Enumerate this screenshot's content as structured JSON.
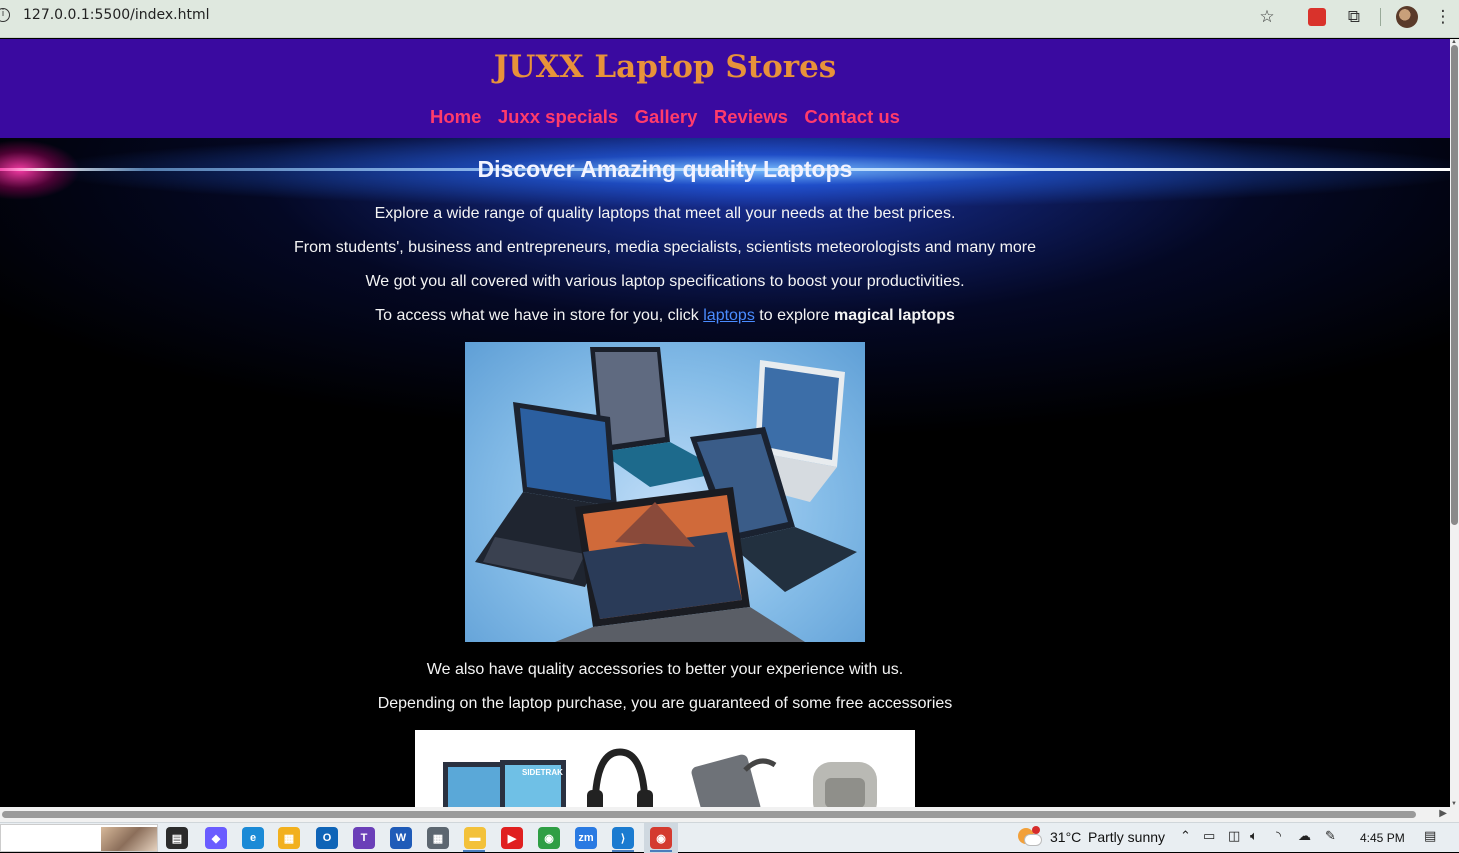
{
  "browser": {
    "url": "127.0.0.1:5500/index.html",
    "icons": [
      "info-icon",
      "star-icon",
      "extension-red-icon",
      "puzzle-icon",
      "profile-avatar",
      "kebab-menu-icon"
    ]
  },
  "site": {
    "title": "JUXX Laptop Stores",
    "colors": {
      "header_bg": "#3a0aa0",
      "title": "#e8923a",
      "nav": "#ff3b6b",
      "link": "#4a8cff"
    },
    "nav": [
      {
        "label": "Home"
      },
      {
        "label": "Juxx specials"
      },
      {
        "label": "Gallery"
      },
      {
        "label": "Reviews"
      },
      {
        "label": "Contact us"
      }
    ]
  },
  "main": {
    "heading": "Discover Amazing quality Laptops",
    "p1": "Explore a wide range of quality laptops that meet all your needs at the best prices.",
    "p2": "From students', business and entrepreneurs, media specialists, scientists meteorologists and many more",
    "p3": "We got you all covered with various laptop specifications to boost your productivities.",
    "p4": {
      "before": "To access what we have in store for you, click ",
      "link": "laptops",
      "middle": " to explore ",
      "bold": "magical laptops"
    },
    "p5": "We also have quality accessories to better your experience with us.",
    "p6": "Depending on the laptop purchase, you are guaranteed of some free accessories",
    "accessory_brand": "SIDETRAK"
  },
  "taskbar": {
    "weather_temp": "31°C",
    "weather_desc": "Partly sunny",
    "time": "4:45 PM",
    "apps": [
      {
        "name": "task-view-icon",
        "color": "#2b2b2b",
        "glyph": "▤"
      },
      {
        "name": "copilot-icon",
        "color": "#6a5cff",
        "glyph": "◆"
      },
      {
        "name": "edge-icon",
        "color": "#1b8ad6",
        "glyph": "e"
      },
      {
        "name": "store-icon",
        "color": "#f2b01e",
        "glyph": "▦"
      },
      {
        "name": "outlook-icon",
        "color": "#0f64b7",
        "glyph": "O"
      },
      {
        "name": "teams-icon",
        "color": "#6b3fb8",
        "glyph": "T"
      },
      {
        "name": "word-icon",
        "color": "#1f5bb8",
        "glyph": "W"
      },
      {
        "name": "calculator-icon",
        "color": "#5c6670",
        "glyph": "▦"
      },
      {
        "name": "file-explorer-icon",
        "color": "#f3c13a",
        "glyph": "▬"
      },
      {
        "name": "youtube-icon",
        "color": "#e02020",
        "glyph": "▶"
      },
      {
        "name": "chrome-icon",
        "color": "#2f9e44",
        "glyph": "◉"
      },
      {
        "name": "zoom-icon",
        "color": "#2a7ae2",
        "glyph": "zm"
      },
      {
        "name": "vscode-icon",
        "color": "#1b7bd0",
        "glyph": "⟩"
      },
      {
        "name": "chrome-active-icon",
        "color": "#d43a2f",
        "glyph": "◉"
      }
    ]
  }
}
